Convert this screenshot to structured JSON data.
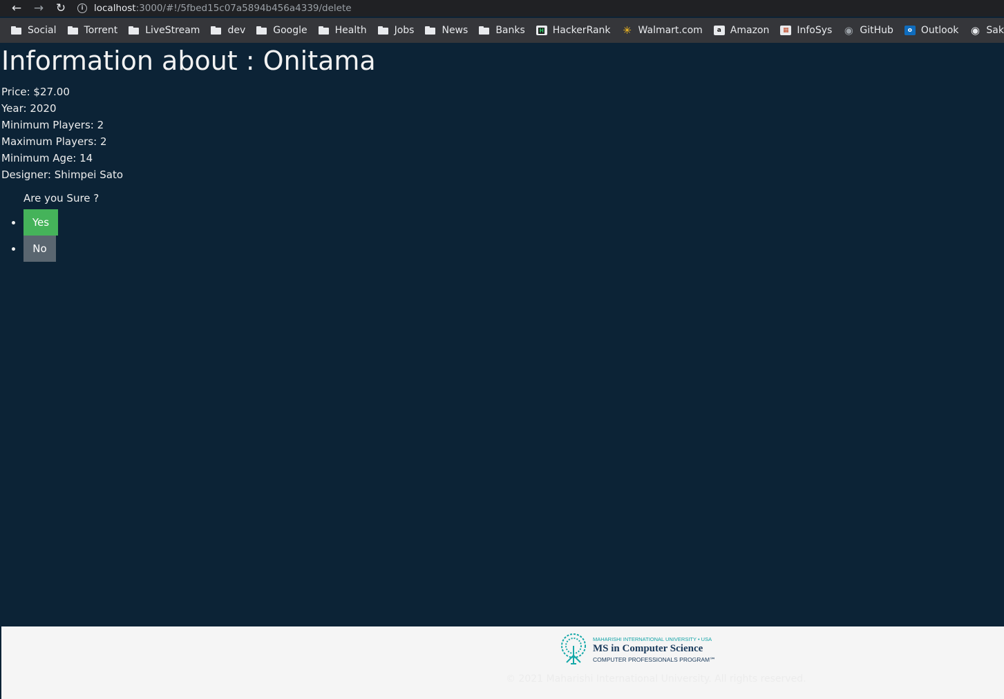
{
  "browser": {
    "url_host": "localhost",
    "url_rest": ":3000/#!/5fbed15c07a5894b456a4339/delete",
    "bookmarks": [
      {
        "label": "Social",
        "icon": "folder-icon"
      },
      {
        "label": "Torrent",
        "icon": "folder-icon"
      },
      {
        "label": "LiveStream",
        "icon": "folder-icon"
      },
      {
        "label": "dev",
        "icon": "folder-icon"
      },
      {
        "label": "Google",
        "icon": "folder-icon"
      },
      {
        "label": "Health",
        "icon": "folder-icon"
      },
      {
        "label": "Jobs",
        "icon": "folder-icon"
      },
      {
        "label": "News",
        "icon": "folder-icon"
      },
      {
        "label": "Banks",
        "icon": "folder-icon"
      },
      {
        "label": "HackerRank",
        "icon": "hackerrank-icon"
      },
      {
        "label": "Walmart.com",
        "icon": "walmart-icon"
      },
      {
        "label": "Amazon",
        "icon": "amazon-icon"
      },
      {
        "label": "InfoSys",
        "icon": "infosys-icon"
      },
      {
        "label": "GitHub",
        "icon": "github-icon"
      },
      {
        "label": "Outlook",
        "icon": "outlook-icon"
      },
      {
        "label": "Saka",
        "icon": "sakai-icon"
      }
    ]
  },
  "game": {
    "title": "Information about : Onitama",
    "price": "Price: $27.00",
    "year": "Year: 2020",
    "min_players": "Minimum Players: 2",
    "max_players": "Maximum Players: 2",
    "min_age": "Minimum Age: 14",
    "designer": "Designer: Shimpei Sato"
  },
  "confirm": {
    "question": "Are you Sure ?",
    "yes_label": "Yes",
    "no_label": "No",
    "yes_color": "#45b35a",
    "no_color": "#5a6670"
  },
  "footer": {
    "logo_top": "MAHARISHI INTERNATIONAL UNIVERSITY • USA",
    "logo_main": "MS in Computer Science",
    "logo_sub": "COMPUTER PROFESSIONALS PROGRAM℠",
    "copyright": "© 2021 Maharishi International University. All rights reserved."
  }
}
